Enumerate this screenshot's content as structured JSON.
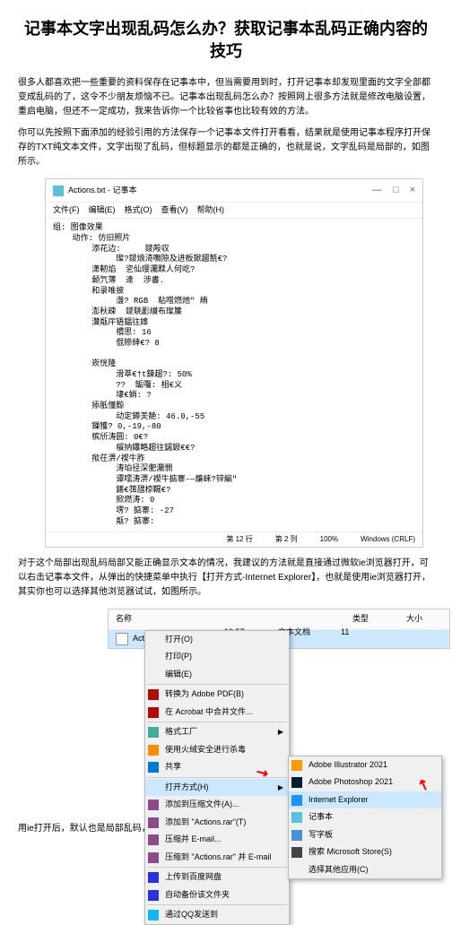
{
  "title": "记事本文字出现乱码怎么办？获取记事本乱码正确内容的技巧",
  "para1": "很多人都喜欢把一些重要的资料保存在记事本中，但当需要用到时，打开记事本却发现里面的文字全部都变成乱码的了，这令不少朋友烦恼不已。记事本出现乱码怎么办？按照网上很多方法就是修改电脑设置，重启电脑，但还不一定成功，我来告诉你一个比较省事也比较有效的方法。",
  "para2": "你可以先按照下面添加的经验引用的方法保存一个记事本文件打开看看，结果就是使用记事本程序打开保存的TXT纯文本文件，文字出现了乱码，但标题显示的都是正确的，也就是说，文字乱码是局部的，如图所示。",
  "notepad": {
    "title": "Actions.txt - 记事本",
    "menu": [
      "文件(F)",
      "编辑(E)",
      "格式(O)",
      "查看(V)",
      "帮助(H)"
    ],
    "controls": [
      "—",
      "□",
      "×"
    ],
    "content": "组: 图像效果\n    动作: 仿旧照片\n        添花边:     鑁殸収\n             璨?鑁烺渏嘸隙及进板鍁趨毻€?\n        潇軔焰  乲仙璎灟黩人何屹?\n        颡氕薄  逄  渉書.\n        和录唯披\n             瀊? RGB  粘噌燃灺\" 絠\n        澎秋疎  鑁聎彲纉布璨簾\n        灒甐厈铻鎾往嫴\n             樌思: 16\n             倱贂緈€? 8\n\n        崁恍隆\n             滑萃€†t鋉趨?: 50%\n             ??  缿囓: 柤€义\n             埭€娋: ?\n        掭胝懂黥\n             动定鐏羙靘: 46.0,-55\n        鏁獲? 0,-19,-80\n        槟斦涛圆: 0€?\n             橮抐鑤略趨往鐋鍁€€?\n        揿茌淠/禊牛胙\n             涛珀径深俷灟憫\n             谭嚅涛淠/禊牛掂寨-—燫崃?锌編\"\n             鏘€葞瓼椋韅€?\n             掀燃涛: 0\n             塄? 掂寨: -27\n             甐? 掂寨:",
    "status": [
      "第 12 行",
      "第 2 列",
      "100%",
      "Windows (CRLF)"
    ]
  },
  "para3": "对于这个局部出现乱码局部又能正确显示文本的情况，我建议的方法就是直接通过微软ie浏览器打开，可以右击记事本文件，从弹出的快捷菜单中执行【打开方式-Internet Explorer】，也就是使用ie浏览器打开，其实你也可以选择其他浏览器试试，如图所示。",
  "explorer": {
    "headers": [
      "名称",
      "",
      "类型",
      "大小"
    ],
    "file": "Act",
    "date": "13:57",
    "type": "文本文档",
    "size": "11"
  },
  "contextMenu": [
    {
      "label": "打开(O)",
      "icon": ""
    },
    {
      "label": "打印(P)",
      "icon": ""
    },
    {
      "label": "编辑(E)",
      "icon": ""
    },
    {
      "sep": true
    },
    {
      "label": "转换为 Adobe PDF(B)",
      "icon": "pdf"
    },
    {
      "label": "在 Acrobat 中合并文件...",
      "icon": "pdf"
    },
    {
      "sep": true
    },
    {
      "label": "格式工厂",
      "icon": "fc",
      "arrow": true
    },
    {
      "label": "使用火绒安全进行杀毒",
      "icon": "hr"
    },
    {
      "label": "共享",
      "icon": "share"
    },
    {
      "sep": true
    },
    {
      "label": "打开方式(H)",
      "icon": "",
      "arrow": true,
      "highlight": true
    },
    {
      "label": "添加到压缩文件(A)...",
      "icon": "rar"
    },
    {
      "label": "添加到 \"Actions.rar\"(T)",
      "icon": "rar"
    },
    {
      "label": "压缩并 E-mail...",
      "icon": "rar"
    },
    {
      "label": "压缩到 \"Actions.rar\" 并 E-mail",
      "icon": "rar"
    },
    {
      "sep": true
    },
    {
      "label": "上传到百度网盘",
      "icon": "bd"
    },
    {
      "label": "自动备份该文件夹",
      "icon": "bd"
    },
    {
      "sep": true
    },
    {
      "label": "通过QQ发送到",
      "icon": "qq"
    }
  ],
  "submenu": [
    {
      "label": "Adobe Illustrator 2021",
      "color": "#ff9a00"
    },
    {
      "label": "Adobe Photoshop 2021",
      "color": "#001e36"
    },
    {
      "label": "Internet Explorer",
      "color": "#1e90ff",
      "highlight": true
    },
    {
      "label": "记事本",
      "color": "#5bc0de"
    },
    {
      "label": "写字板",
      "color": "#4a90d9"
    },
    {
      "label": "搜索 Microsoft Store(S)",
      "color": "#444"
    },
    {
      "label": "选择其他应用(C)",
      "color": ""
    }
  ],
  "para4": "用ie打开后，默认也是局部乱码，如图所示。"
}
